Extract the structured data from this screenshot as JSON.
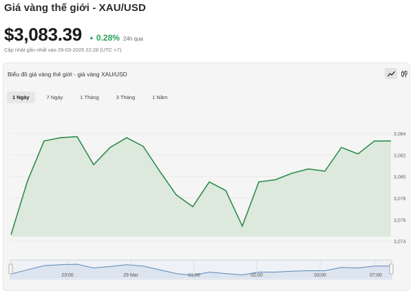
{
  "header": {
    "title": "Giá vàng thế giới - XAU/USD",
    "price": "$3,083.39",
    "change": "0.28%",
    "change_period": "24h qua",
    "updated": "Cập nhật gần nhất vào 29-03-2025 22:28 (UTC +7)"
  },
  "panel": {
    "title": "Biểu đồ giá vàng thế giới - giá vàng XAU/USD",
    "tabs": [
      {
        "label": "1 Ngày",
        "active": true
      },
      {
        "label": "7 Ngày",
        "active": false
      },
      {
        "label": "1 Tháng",
        "active": false
      },
      {
        "label": "3 Tháng",
        "active": false
      },
      {
        "label": "1 Năm",
        "active": false
      }
    ]
  },
  "colors": {
    "line": "#2e8b4a",
    "fill": "#dde9dd",
    "up": "#27a35a",
    "navigator_line": "#5b86b8",
    "navigator_fill": "#dbe4ef"
  },
  "icons": {
    "up": "up-triangle-icon",
    "line_tool": "line-chart-icon",
    "candle_tool": "candlestick-icon"
  },
  "chart_data": {
    "type": "area",
    "y": [
      3074.6,
      3079.6,
      3083.3,
      3083.6,
      3083.7,
      3081.1,
      3082.7,
      3083.6,
      3082.8,
      3080.5,
      3078.3,
      3077.2,
      3079.5,
      3078.7,
      3075.4,
      3079.5,
      3079.7,
      3080.3,
      3080.7,
      3080.5,
      3082.7,
      3082.1,
      3083.3,
      3083.3
    ],
    "ylim": [
      3073.4,
      3085.4
    ],
    "y_ticks": [
      "3,074",
      "3,076",
      "3,078",
      "3,080",
      "3,082",
      "3,084"
    ],
    "x_ticks": [
      "23:00",
      "29 Mar",
      "01:00",
      "02:00",
      "03:00",
      "07:00"
    ],
    "navigator_y": [
      3081.5,
      3082.4,
      3083.3,
      3083.5,
      3083.6,
      3082.8,
      3083.1,
      3083.5,
      3083.2,
      3082.4,
      3081.6,
      3081.2,
      3081.9,
      3081.6,
      3081.3,
      3081.9,
      3081.9,
      3082.1,
      3082.2,
      3082.2,
      3082.9,
      3082.8,
      3083.2,
      3083.2
    ],
    "grid": "horizontal",
    "y_axis": "right"
  }
}
